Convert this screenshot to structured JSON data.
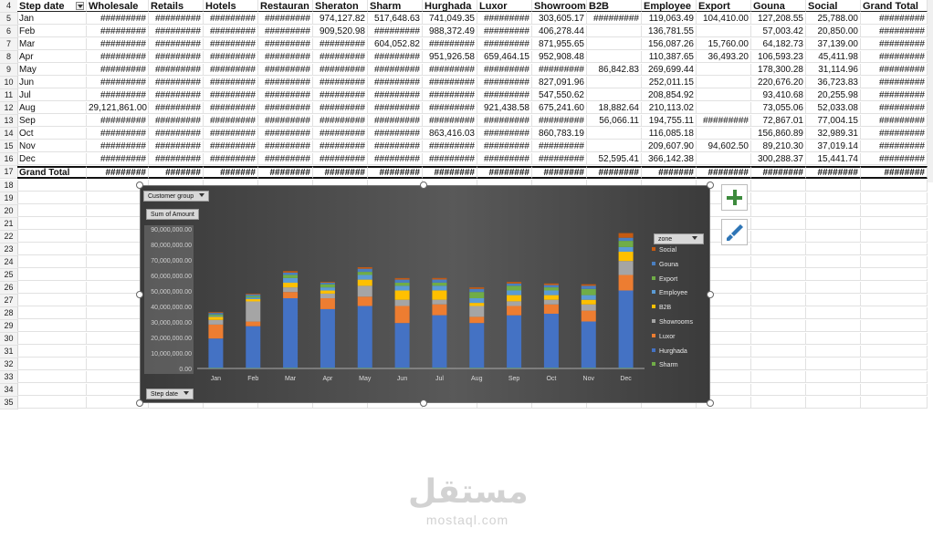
{
  "sheet": {
    "header_row_num": "4",
    "columns": [
      "Step date",
      "Wholesale",
      "Retails",
      "Hotels",
      "Restauran",
      "Sheraton",
      "Sharm",
      "Hurghada",
      "Luxor",
      "Showroom",
      "B2B",
      "Employee",
      "Export",
      "Gouna",
      "Social",
      "Grand Total"
    ],
    "rows": [
      {
        "num": "5",
        "cells": [
          "Jan",
          "#########",
          "#########",
          "#########",
          "#########",
          "974,127.82",
          "517,648.63",
          "741,049.35",
          "#########",
          "303,605.17",
          "#########",
          "119,063.49",
          "104,410.00",
          "127,208.55",
          "25,788.00",
          "#########"
        ]
      },
      {
        "num": "6",
        "cells": [
          "Feb",
          "#########",
          "#########",
          "#########",
          "#########",
          "909,520.98",
          "#########",
          "988,372.49",
          "#########",
          "406,278.44",
          "",
          "136,781.55",
          "",
          "57,003.42",
          "20,850.00",
          "#########"
        ]
      },
      {
        "num": "7",
        "cells": [
          "Mar",
          "#########",
          "#########",
          "#########",
          "#########",
          "#########",
          "604,052.82",
          "#########",
          "#########",
          "871,955.65",
          "",
          "156,087.26",
          "15,760.00",
          "64,182.73",
          "37,139.00",
          "#########"
        ]
      },
      {
        "num": "8",
        "cells": [
          "Apr",
          "#########",
          "#########",
          "#########",
          "#########",
          "#########",
          "#########",
          "951,926.58",
          "659,464.15",
          "952,908.48",
          "",
          "110,387.65",
          "36,493.20",
          "106,593.23",
          "45,411.98",
          "#########"
        ]
      },
      {
        "num": "9",
        "cells": [
          "May",
          "#########",
          "#########",
          "#########",
          "#########",
          "#########",
          "#########",
          "#########",
          "#########",
          "#########",
          "86,842.83",
          "269,699.44",
          "",
          "178,300.28",
          "31,114.96",
          "#########"
        ]
      },
      {
        "num": "10",
        "cells": [
          "Jun",
          "#########",
          "#########",
          "#########",
          "#########",
          "#########",
          "#########",
          "#########",
          "#########",
          "827,091.96",
          "",
          "252,011.15",
          "",
          "220,676.20",
          "36,723.83",
          "#########"
        ]
      },
      {
        "num": "11",
        "cells": [
          "Jul",
          "#########",
          "#########",
          "#########",
          "#########",
          "#########",
          "#########",
          "#########",
          "#########",
          "547,550.62",
          "",
          "208,854.92",
          "",
          "93,410.68",
          "20,255.98",
          "#########"
        ]
      },
      {
        "num": "12",
        "cells": [
          "Aug",
          "29,121,861.00",
          "#########",
          "#########",
          "#########",
          "#########",
          "#########",
          "#########",
          "921,438.58",
          "675,241.60",
          "18,882.64",
          "210,113.02",
          "",
          "73,055.06",
          "52,033.08",
          "#########"
        ]
      },
      {
        "num": "13",
        "cells": [
          "Sep",
          "#########",
          "#########",
          "#########",
          "#########",
          "#########",
          "#########",
          "#########",
          "#########",
          "#########",
          "56,066.11",
          "194,755.11",
          "#########",
          "72,867.01",
          "77,004.15",
          "#########"
        ]
      },
      {
        "num": "14",
        "cells": [
          "Oct",
          "#########",
          "#########",
          "#########",
          "#########",
          "#########",
          "#########",
          "863,416.03",
          "#########",
          "860,783.19",
          "",
          "116,085.18",
          "",
          "156,860.89",
          "32,989.31",
          "#########"
        ]
      },
      {
        "num": "15",
        "cells": [
          "Nov",
          "#########",
          "#########",
          "#########",
          "#########",
          "#########",
          "#########",
          "#########",
          "#########",
          "#########",
          "",
          "209,607.90",
          "94,602.50",
          "89,210.30",
          "37,019.14",
          "#########"
        ]
      },
      {
        "num": "16",
        "cells": [
          "Dec",
          "#########",
          "#########",
          "#########",
          "#########",
          "#########",
          "#########",
          "#########",
          "#########",
          "#########",
          "52,595.41",
          "366,142.38",
          "",
          "300,288.37",
          "15,441.74",
          "#########"
        ]
      }
    ],
    "grand": {
      "num": "17",
      "cells": [
        "Grand Total",
        "########",
        "#######",
        "#######",
        "########",
        "########",
        "########",
        "########",
        "########",
        "########",
        "########",
        "#######",
        "########",
        "########",
        "########",
        "########"
      ]
    },
    "empty_row_nums": [
      "18",
      "19",
      "20",
      "21",
      "22",
      "23",
      "24",
      "25",
      "26",
      "27",
      "28",
      "29",
      "30",
      "31",
      "32",
      "33",
      "34",
      "35"
    ]
  },
  "chart_buttons": {
    "customer_group": "Customer group",
    "sum_of_amount": "Sum of Amount",
    "zone": "zone",
    "step_date": "Step date"
  },
  "chart_data": {
    "type": "bar",
    "stacked": true,
    "categories": [
      "Jan",
      "Feb",
      "Mar",
      "Apr",
      "May",
      "Jun",
      "Jul",
      "Aug",
      "Sep",
      "Oct",
      "Nov",
      "Dec"
    ],
    "y_tick_labels": [
      "0.00",
      "10,000,000.00",
      "20,000,000.00",
      "30,000,000.00",
      "40,000,000.00",
      "50,000,000.00",
      "60,000,000.00",
      "70,000,000.00",
      "80,000,000.00",
      "90,000,000.00"
    ],
    "ylim": [
      0,
      90000000
    ],
    "series": [
      {
        "name": "Sharm",
        "color": "#70ad47",
        "values": [
          300000,
          250000,
          300000,
          280000,
          300000,
          300000,
          350000,
          300000,
          300000,
          300000,
          300000,
          300000
        ]
      },
      {
        "name": "Hurghada",
        "color": "#4472c4",
        "values": [
          19000000,
          27000000,
          45000000,
          38000000,
          40000000,
          29000000,
          34000000,
          29000000,
          34000000,
          35000000,
          30000000,
          50000000
        ]
      },
      {
        "name": "Luxor",
        "color": "#ed7d31",
        "values": [
          9000000,
          3000000,
          4000000,
          7000000,
          6000000,
          11000000,
          7000000,
          4000000,
          6000000,
          6000000,
          7000000,
          10000000
        ]
      },
      {
        "name": "Showrooms",
        "color": "#a5a5a5",
        "values": [
          3000000,
          13000000,
          3000000,
          3000000,
          7000000,
          4000000,
          3000000,
          7000000,
          3000000,
          3000000,
          4000000,
          9000000
        ]
      },
      {
        "name": "B2B",
        "color": "#ffc000",
        "values": [
          2000000,
          1500000,
          3000000,
          2000000,
          4000000,
          6000000,
          6000000,
          2000000,
          4000000,
          3000000,
          3000000,
          6000000
        ]
      },
      {
        "name": "Employee",
        "color": "#5b9bd5",
        "values": [
          500000,
          1000000,
          3000000,
          2000000,
          3000000,
          3000000,
          3000000,
          3000000,
          3000000,
          3000000,
          3000000,
          3000000
        ]
      },
      {
        "name": "Export",
        "color": "#70ad47",
        "values": [
          1000000,
          1000000,
          2000000,
          2000000,
          2000000,
          2000000,
          2000000,
          4000000,
          3000000,
          2000000,
          4000000,
          4000000
        ]
      },
      {
        "name": "Gouna",
        "color": "#4a7fc1",
        "values": [
          1000000,
          1000000,
          1500000,
          1000000,
          2000000,
          2000000,
          2000000,
          2000000,
          1500000,
          1500000,
          2000000,
          2000000
        ]
      },
      {
        "name": "Social",
        "color": "#c55a11",
        "values": [
          500000,
          500000,
          1000000,
          500000,
          1000000,
          1000000,
          1000000,
          1000000,
          1000000,
          1000000,
          1000000,
          3000000
        ]
      }
    ],
    "legend_order": [
      "Social",
      "Gouna",
      "Export",
      "Employee",
      "B2B",
      "Showrooms",
      "Luxor",
      "Hurghada",
      "Sharm"
    ],
    "legend_position": "right",
    "grid": false
  },
  "watermark": {
    "arabic": "مستقل",
    "latin": "mostaql.com"
  },
  "colors": {
    "chart_bg": "#595959",
    "plus_green": "#3d8b3d",
    "brush_blue": "#2e75b6"
  }
}
